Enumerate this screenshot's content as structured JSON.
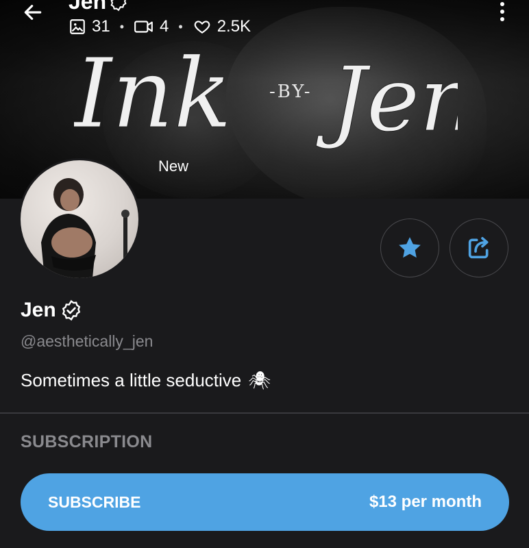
{
  "header": {
    "title": "Jen",
    "stats": {
      "images": "31",
      "videos": "4",
      "likes": "2.5K"
    }
  },
  "cover": {
    "logo_main_left": "Ink",
    "logo_by": "-BY-",
    "logo_main_right": "Jen"
  },
  "profile": {
    "status": "New",
    "name": "Jen",
    "handle": "@aesthetically_jen",
    "bio": "Sometimes a little seductive",
    "bio_emoji": "🕷"
  },
  "subscription": {
    "section_title": "SUBSCRIPTION",
    "button_label": "SUBSCRIBE",
    "price": "$13 per month"
  },
  "icons": {
    "back": "arrow-left-icon",
    "images": "image-icon",
    "videos": "video-icon",
    "likes": "heart-icon",
    "more": "more-vertical-icon",
    "verified": "verified-badge-icon",
    "favorite": "star-icon",
    "share": "share-icon"
  },
  "colors": {
    "background": "#1a1a1c",
    "accent": "#4fa3e3",
    "muted_text": "#8a8a8e",
    "divider": "#3a3a3e"
  }
}
